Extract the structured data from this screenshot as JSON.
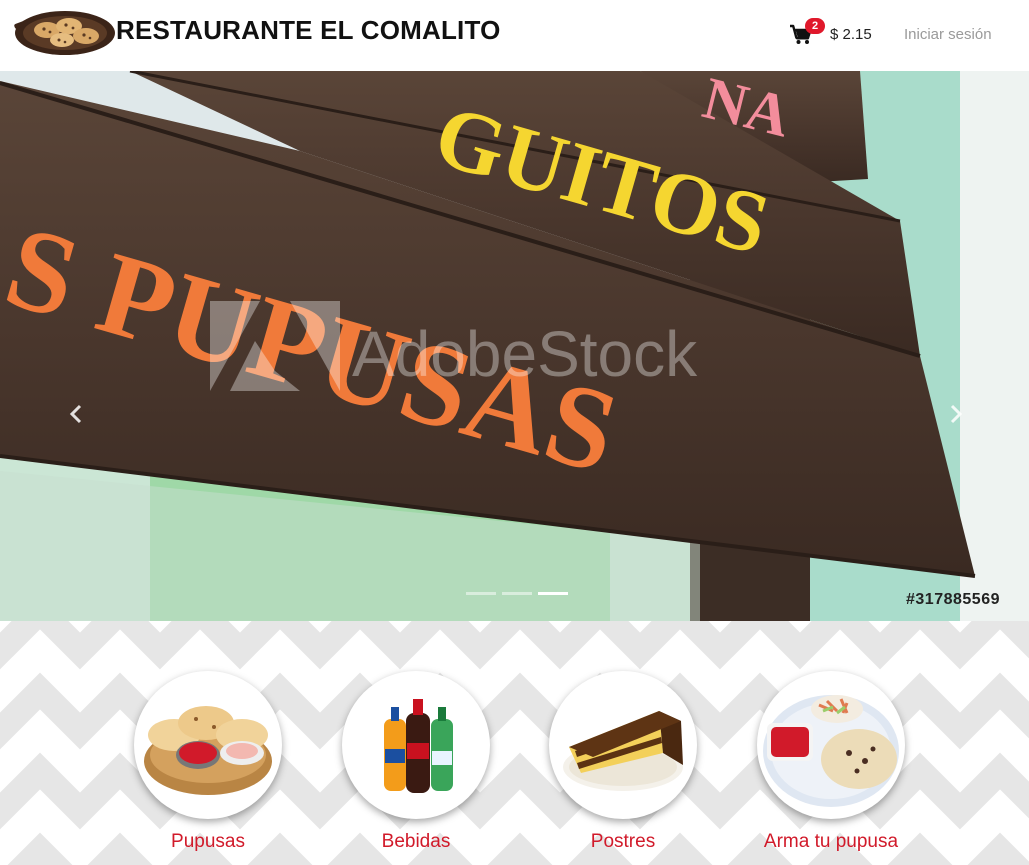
{
  "header": {
    "brand_name": "RESTAURANTE EL COMALITO",
    "logo_icon": "comal-logo-icon",
    "cart_icon": "shopping-cart-icon",
    "cart_count": "2",
    "cart_total": "$ 2.15",
    "login_label": "Iniciar sesión"
  },
  "carousel": {
    "sign_words": [
      "GUITOS",
      "S PUPUSAS",
      "NA"
    ],
    "watermark": "AdobeStock",
    "stock_id": "#317885569",
    "prev_icon": "chevron-left-icon",
    "next_icon": "chevron-right-icon",
    "indicator_count": 3,
    "active_indicator": 2
  },
  "categories": [
    {
      "label": "Pupusas",
      "icon": "pupusas-plate-icon"
    },
    {
      "label": "Bebidas",
      "icon": "soda-bottles-icon"
    },
    {
      "label": "Postres",
      "icon": "cake-slice-icon"
    },
    {
      "label": "Arma tu pupusa",
      "icon": "build-pupusa-icon"
    }
  ],
  "colors": {
    "accent_red": "#d11a2a",
    "badge_red": "#e0182b",
    "sign_orange": "#f07a3a",
    "sign_yellow": "#f5d630",
    "wall_mint": "#a9dccb",
    "chevron_gray": "#e6e6e6"
  }
}
